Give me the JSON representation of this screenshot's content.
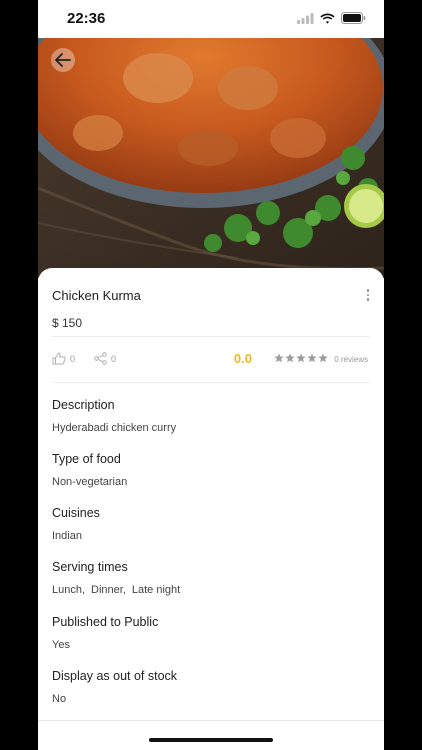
{
  "status": {
    "time": "22:36"
  },
  "item": {
    "name": "Chicken Kurma",
    "price": "$ 150",
    "likes": "0",
    "shares": "0",
    "rating": "0.0",
    "stars_filled": 0,
    "stars_total": 5,
    "reviews": "0 reviews"
  },
  "fields": [
    {
      "label": "Description",
      "value": "Hyderabadi chicken curry"
    },
    {
      "label": "Type of food",
      "value": "Non-vegetarian"
    },
    {
      "label": "Cuisines",
      "value": "Indian"
    },
    {
      "label": "Serving times",
      "values": [
        "Lunch,",
        "Dinner,",
        "Late night"
      ]
    },
    {
      "label": "Published to Public",
      "value": "Yes"
    },
    {
      "label": "Display as out of stock",
      "value": "No"
    }
  ],
  "colors": {
    "accent": "#f0b824",
    "background": "#ffffff"
  },
  "icons": [
    "back-arrow-icon",
    "more-vertical-icon",
    "like-icon",
    "share-icon",
    "star-icon"
  ]
}
